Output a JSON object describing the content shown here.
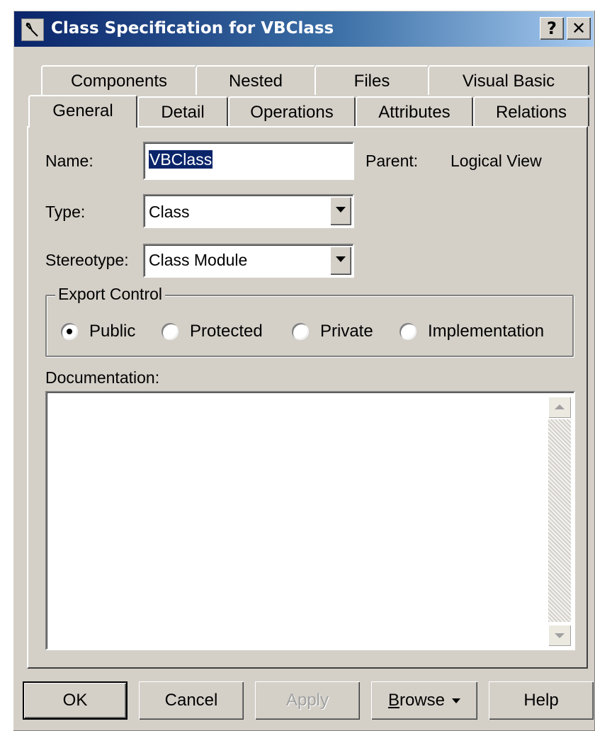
{
  "window": {
    "title": "Class Specification for VBClass",
    "help_label": "?",
    "close_label": "✕"
  },
  "tabs": {
    "row1": [
      "Components",
      "Nested",
      "Files",
      "Visual Basic"
    ],
    "row2": [
      "General",
      "Detail",
      "Operations",
      "Attributes",
      "Relations"
    ],
    "active": "General"
  },
  "general": {
    "name_label": "Name:",
    "name_value": "VBClass",
    "parent_label": "Parent:",
    "parent_value": "Logical View",
    "type_label": "Type:",
    "type_value": "Class",
    "stereotype_label": "Stereotype:",
    "stereotype_value": "Class Module",
    "export_control": {
      "title": "Export Control",
      "options": [
        "Public",
        "Protected",
        "Private",
        "Implementation"
      ],
      "selected": "Public"
    },
    "documentation_label": "Documentation:",
    "documentation_value": ""
  },
  "buttons": {
    "ok": "OK",
    "cancel": "Cancel",
    "apply": "Apply",
    "browse_prefix": "B",
    "browse_rest": "rowse",
    "help": "Help"
  }
}
